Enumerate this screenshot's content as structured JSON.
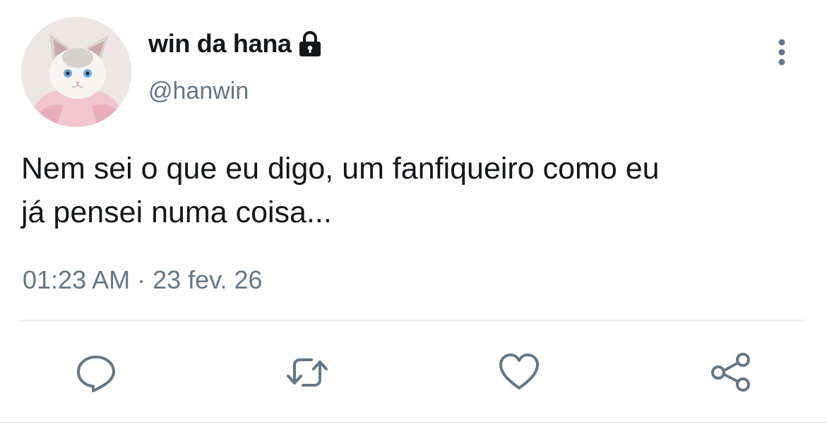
{
  "user": {
    "display_name": "win da hana",
    "handle": "@hanwin",
    "avatar_icon": "cat-avatar",
    "locked_icon": "lock-icon"
  },
  "tweet": {
    "text": "Nem sei o que eu digo, um fanfiqueiro como eu\njá pensei numa coisa...",
    "timestamp": "01:23 AM · 23 fev. 26"
  },
  "actions": {
    "reply_icon": "reply-icon",
    "retweet_icon": "retweet-icon",
    "like_icon": "heart-icon",
    "share_icon": "share-icon",
    "more_icon": "more-vertical-icon"
  },
  "colors": {
    "text_primary": "#14171a",
    "text_secondary": "#657786",
    "divider": "#e6ecf0"
  }
}
